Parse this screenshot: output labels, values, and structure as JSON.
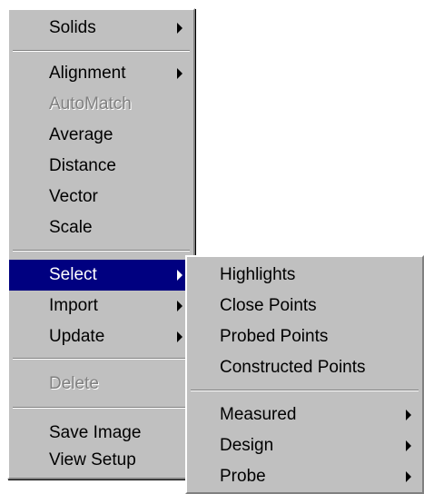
{
  "main_menu": {
    "solids": "Solids",
    "alignment": "Alignment",
    "automatch": "AutoMatch",
    "average": "Average",
    "distance": "Distance",
    "vector": "Vector",
    "scale": "Scale",
    "select": "Select",
    "import": "Import",
    "update": "Update",
    "delete": "Delete",
    "save_image": "Save Image",
    "view_setup": "View Setup"
  },
  "select_submenu": {
    "highlights": "Highlights",
    "close_points": "Close Points",
    "probed_points": "Probed Points",
    "constructed_points": "Constructed Points",
    "measured": "Measured",
    "design": "Design",
    "probe": "Probe"
  },
  "colors": {
    "menu_bg": "#c0c0c0",
    "highlight_bg": "#000080",
    "disabled_text": "#808080"
  }
}
